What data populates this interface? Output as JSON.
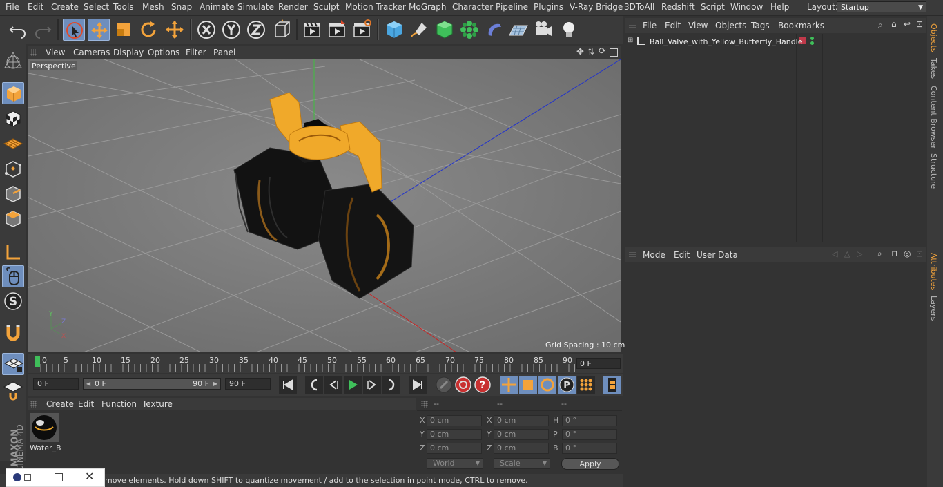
{
  "menu": {
    "items": [
      "File",
      "Edit",
      "Create",
      "Select",
      "Tools",
      "Mesh",
      "Snap",
      "Animate",
      "Simulate",
      "Render",
      "Sculpt",
      "Motion Tracker",
      "MoGraph",
      "Character",
      "Pipeline",
      "Plugins",
      "V-Ray Bridge",
      "3DToAll",
      "Redshift",
      "Script",
      "Window",
      "Help"
    ],
    "layout_label": "Layout:",
    "layout_value": "Startup"
  },
  "viewport": {
    "menu": [
      "View",
      "Cameras",
      "Display",
      "Options",
      "Filter",
      "Panel"
    ],
    "label": "Perspective",
    "grid_spacing": "Grid Spacing : 10 cm",
    "axis_y": "Y",
    "axis_z": "Z",
    "axis_x": "X"
  },
  "timeline": {
    "ticks": [
      "0",
      "5",
      "10",
      "15",
      "20",
      "25",
      "30",
      "35",
      "40",
      "45",
      "50",
      "55",
      "60",
      "65",
      "70",
      "75",
      "80",
      "85",
      "90"
    ],
    "current_frame": "0 F",
    "start_field": "0 F",
    "range_start": "0 F",
    "range_end": "90 F",
    "end_field": "90 F"
  },
  "materials": {
    "menu": [
      "Create",
      "Edit",
      "Function",
      "Texture"
    ],
    "items": [
      {
        "name": "Water_B"
      }
    ]
  },
  "coordinates": {
    "headers": [
      "--",
      "--",
      "--"
    ],
    "rows": [
      {
        "a": "X",
        "av": "0 cm",
        "b": "X",
        "bv": "0 cm",
        "c": "H",
        "cv": "0 °"
      },
      {
        "a": "Y",
        "av": "0 cm",
        "b": "Y",
        "bv": "0 cm",
        "c": "P",
        "cv": "0 °"
      },
      {
        "a": "Z",
        "av": "0 cm",
        "b": "Z",
        "bv": "0 cm",
        "c": "B",
        "cv": "0 °"
      }
    ],
    "world": "World",
    "scale": "Scale",
    "apply": "Apply"
  },
  "status": "move elements. Hold down SHIFT to quantize movement / add to the selection in point mode, CTRL to remove.",
  "brand": {
    "maxon": "MAXON",
    "cinema": "CINEMA 4D"
  },
  "objects": {
    "menu": [
      "File",
      "Edit",
      "View",
      "Objects",
      "Tags",
      "Bookmarks"
    ],
    "items": [
      {
        "name": "Ball_Valve_with_Yellow_Butterfly_Handle"
      }
    ]
  },
  "attributes": {
    "menu": [
      "Mode",
      "Edit",
      "User Data"
    ]
  },
  "right_tabs": [
    "Objects",
    "Takes",
    "Content Browser",
    "Structure",
    "Attributes",
    "Layers"
  ],
  "colors": {
    "accent": "#f3a33b",
    "selection": "#6e8ebd",
    "handle": "#f0a92a"
  }
}
